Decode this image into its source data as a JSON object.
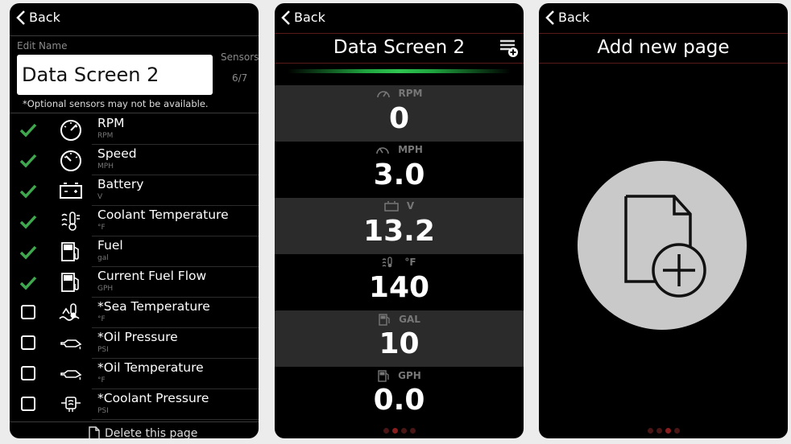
{
  "panel1": {
    "back_label": "Back",
    "edit_name_label": "Edit Name",
    "name_value": "Data Screen 2",
    "sensors_label": "Sensors",
    "sensors_count": "6/7",
    "optional_note": "*Optional sensors may not be available.",
    "sensors": [
      {
        "name": "RPM",
        "unit": "RPM",
        "checked": true,
        "icon": "gauge-icon"
      },
      {
        "name": "Speed",
        "unit": "MPH",
        "checked": true,
        "icon": "speedometer-icon"
      },
      {
        "name": "Battery",
        "unit": "V",
        "checked": true,
        "icon": "battery-icon"
      },
      {
        "name": "Coolant Temperature",
        "unit": "°F",
        "checked": true,
        "icon": "coolant-temperature-icon"
      },
      {
        "name": "Fuel",
        "unit": "gal",
        "checked": true,
        "icon": "fuel-icon"
      },
      {
        "name": "Current Fuel Flow",
        "unit": "GPH",
        "checked": true,
        "icon": "fuel-flow-icon"
      },
      {
        "name": "*Sea Temperature",
        "unit": "°F",
        "checked": false,
        "icon": "sea-temperature-icon"
      },
      {
        "name": "*Oil Pressure",
        "unit": "PSI",
        "checked": false,
        "icon": "oil-pressure-icon"
      },
      {
        "name": "*Oil Temperature",
        "unit": "°F",
        "checked": false,
        "icon": "oil-temperature-icon"
      },
      {
        "name": "*Coolant Pressure",
        "unit": "PSI",
        "checked": false,
        "icon": "coolant-pressure-icon"
      }
    ],
    "delete_label": "Delete this page"
  },
  "panel2": {
    "back_label": "Back",
    "title": "Data Screen 2",
    "readings": [
      {
        "label": "RPM",
        "value": "0",
        "icon": "gauge-icon"
      },
      {
        "label": "MPH",
        "value": "3.0",
        "icon": "speedometer-icon"
      },
      {
        "label": "V",
        "value": "13.2",
        "icon": "battery-icon"
      },
      {
        "label": "°F",
        "value": "140",
        "icon": "coolant-temperature-icon"
      },
      {
        "label": "GAL",
        "value": "10",
        "icon": "fuel-icon"
      },
      {
        "label": "GPH",
        "value": "0.0",
        "icon": "fuel-icon"
      }
    ],
    "page_dots": 4,
    "active_dot": 1
  },
  "panel3": {
    "back_label": "Back",
    "title": "Add new page",
    "page_dots": 4,
    "active_dot": 2
  },
  "colors": {
    "check_green": "#3fa84f",
    "glow_green": "#2fc451",
    "alt_row": "#2b2b2b",
    "circle_gray": "#c9c9c9"
  }
}
